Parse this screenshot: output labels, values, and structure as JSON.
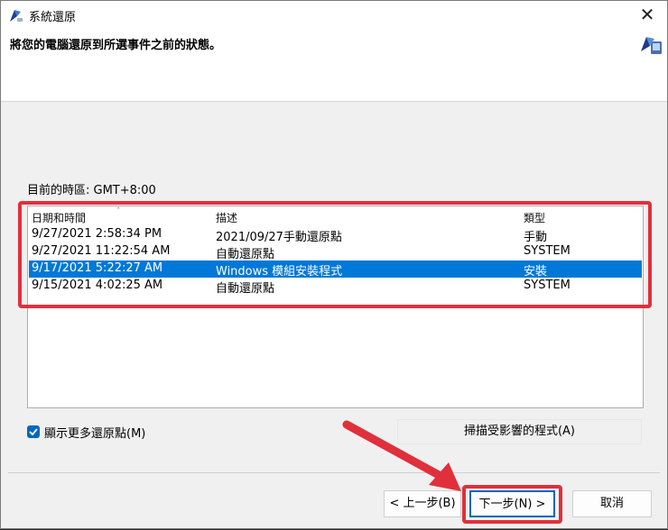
{
  "window": {
    "title": "系統還原",
    "close_glyph": "✕"
  },
  "header": {
    "text": "將您的電腦還原到所選事件之前的狀態。"
  },
  "timezone": {
    "label": "目前的時區: GMT+8:00"
  },
  "table": {
    "columns": [
      "日期和時間",
      "描述",
      "類型"
    ],
    "rows": [
      {
        "date": "9/27/2021 2:58:34 PM",
        "desc": "2021/09/27手動還原點",
        "type": "手動"
      },
      {
        "date": "9/27/2021 11:22:54 AM",
        "desc": "自動還原點",
        "type": "SYSTEM"
      },
      {
        "date": "9/17/2021 5:22:27 AM",
        "desc": "Windows 模組安裝程式",
        "type": "安裝",
        "selected": true
      },
      {
        "date": "9/15/2021 4:02:25 AM",
        "desc": "自動還原點",
        "type": "SYSTEM"
      }
    ]
  },
  "more_points": {
    "label": "顯示更多還原點(M)",
    "checked": true
  },
  "scan_button": {
    "label": "掃描受影響的程式(A)"
  },
  "buttons": {
    "back": "< 上一步(B)",
    "next": "下一步(N) >",
    "cancel": "取消"
  },
  "colors": {
    "selection": "#0078d7",
    "highlight": "#e0303c",
    "accent": "#0067c0"
  }
}
